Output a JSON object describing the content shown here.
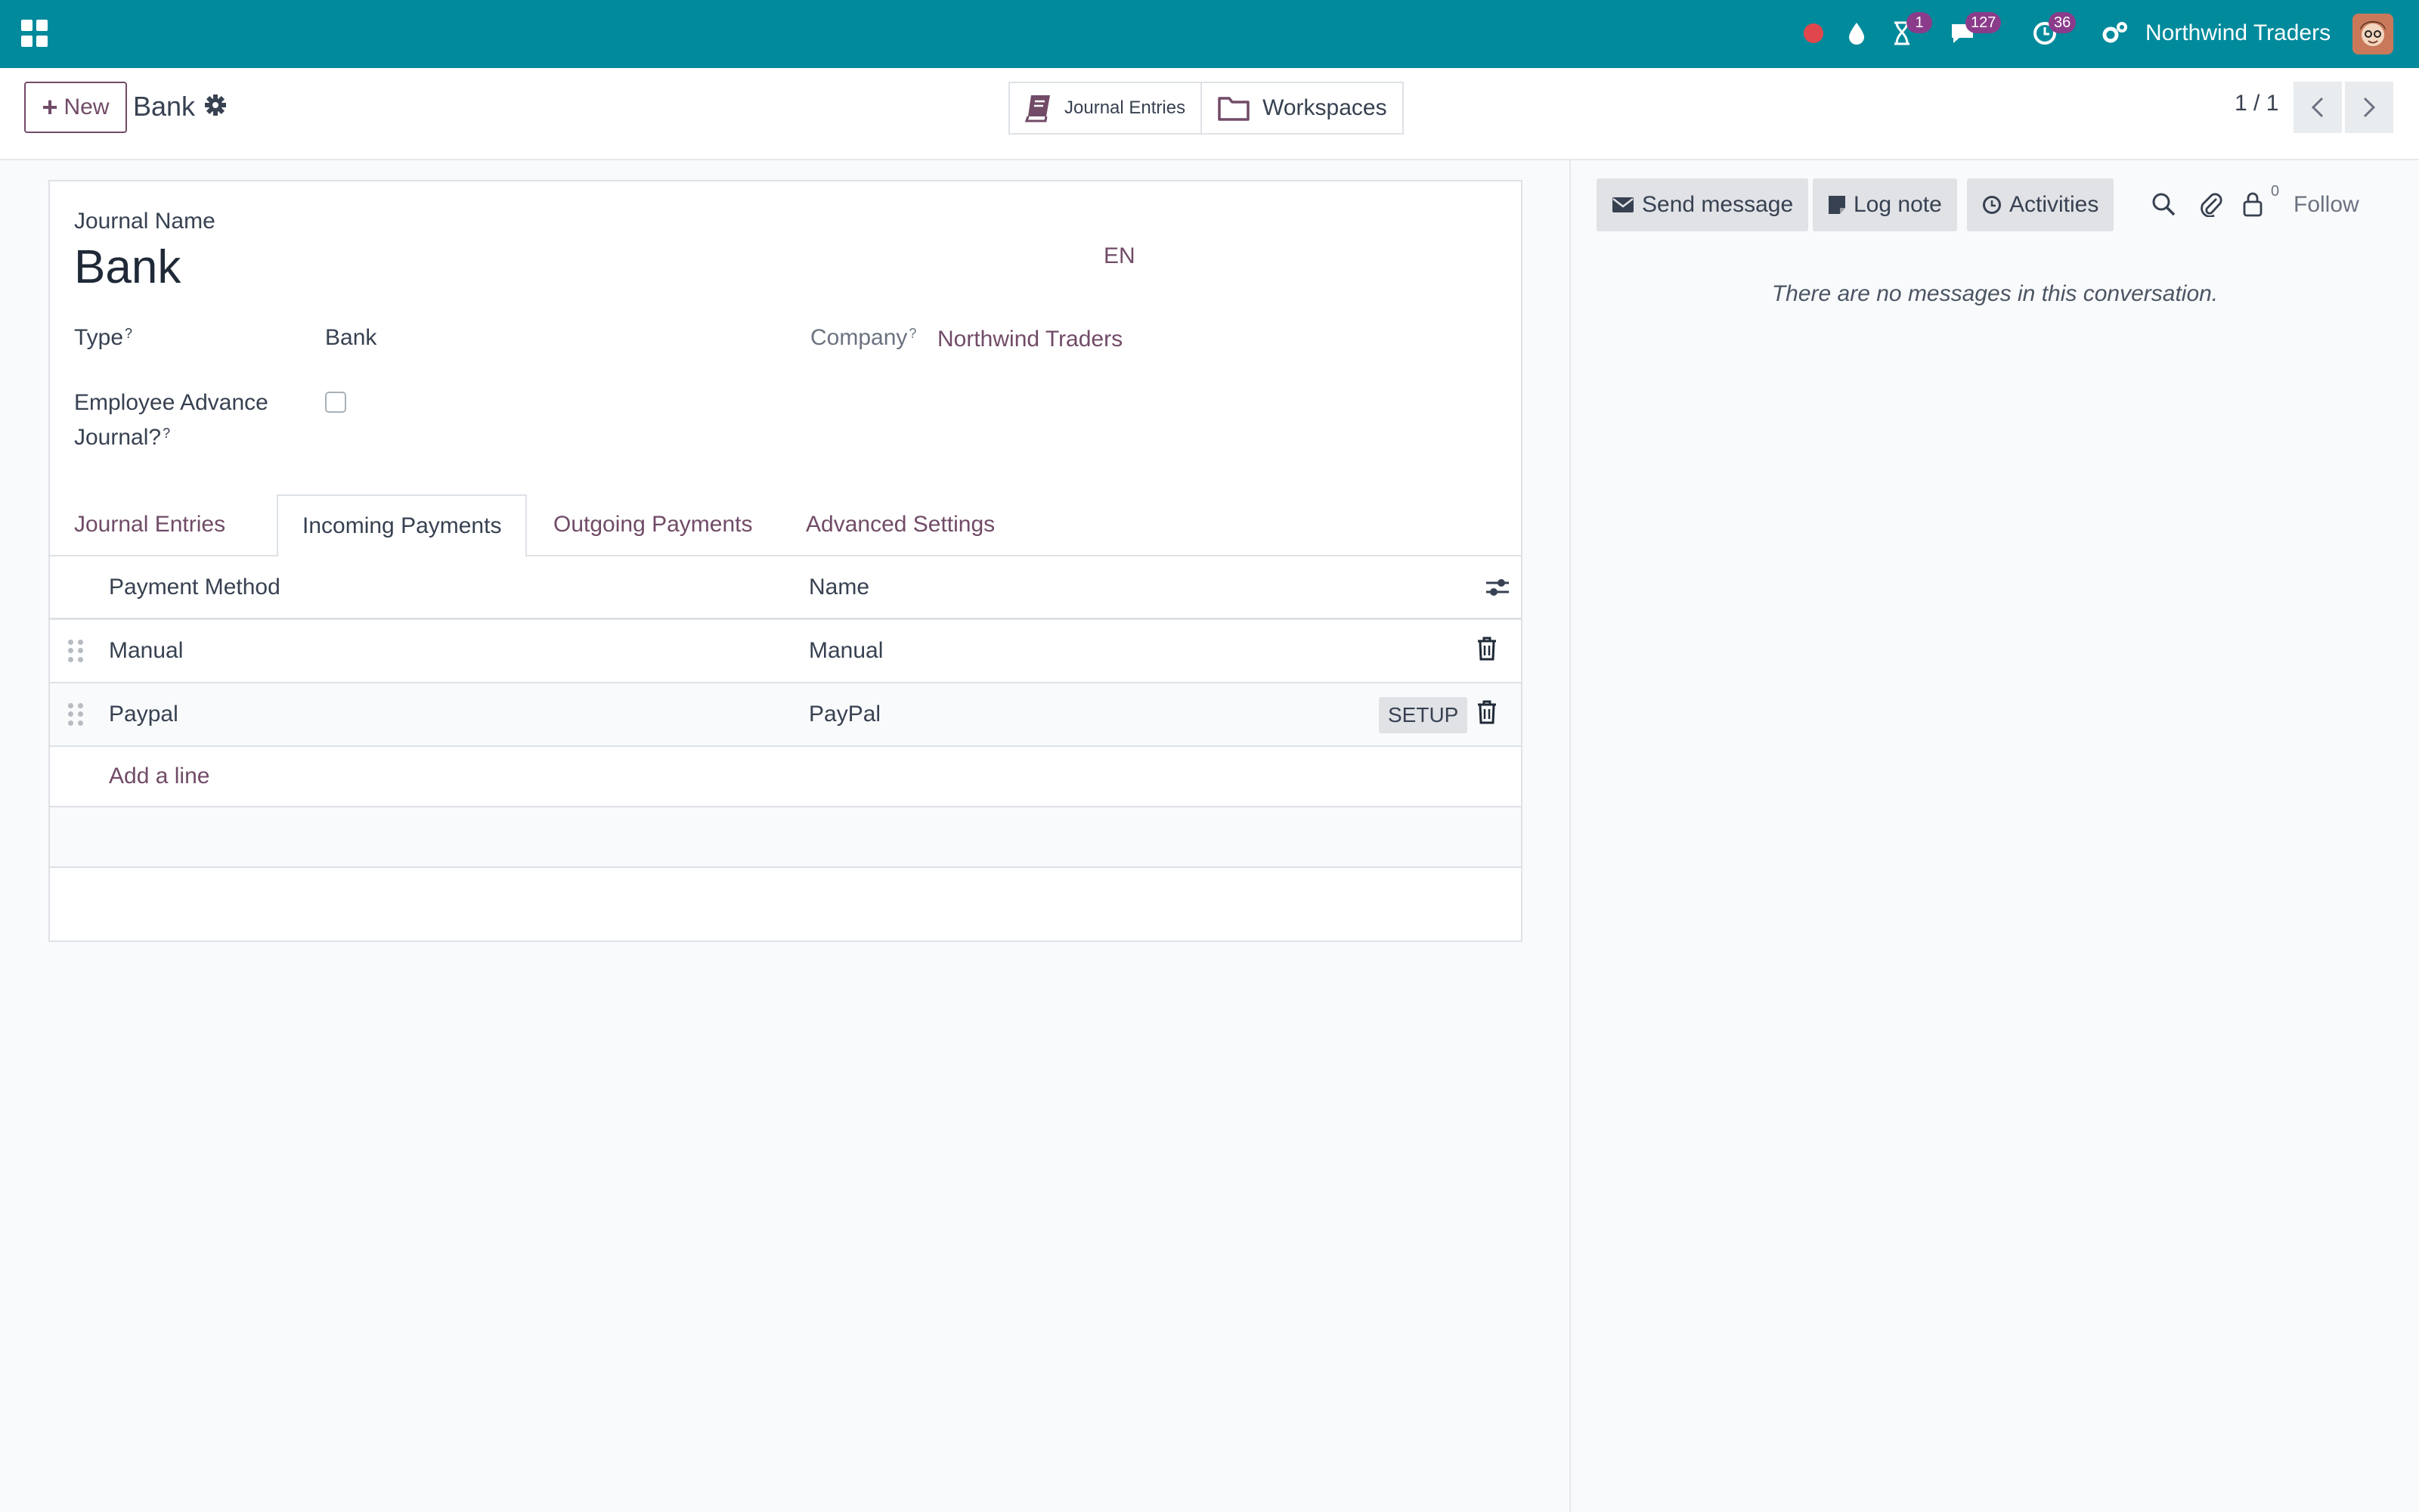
{
  "navbar": {
    "company_name": "Northwind Traders",
    "activity_count": "1",
    "messages_count": "127",
    "clock_count": "36",
    "icons": [
      "apps-icon",
      "record-dot-icon",
      "drop-icon",
      "hourglass-icon",
      "chat-icon",
      "clock-icon",
      "cogs-icon"
    ]
  },
  "control": {
    "new_label": "New",
    "breadcrumb_title": "Bank",
    "smart_buttons": {
      "journal_entries": "Journal Entries",
      "workspaces": "Workspaces"
    },
    "pager": "1 / 1"
  },
  "form": {
    "journal_name_label": "Journal Name",
    "journal_name_value": "Bank",
    "lang": "EN",
    "type_label": "Type",
    "type_value": "Bank",
    "company_label": "Company",
    "company_value": "Northwind Traders",
    "employee_advance_label_line1": "Employee Advance",
    "employee_advance_label_line2": "Journal?",
    "help_mark": "?",
    "employee_advance_checked": false
  },
  "tabs": [
    {
      "label": "Journal Entries"
    },
    {
      "label": "Incoming Payments"
    },
    {
      "label": "Outgoing Payments"
    },
    {
      "label": "Advanced Settings"
    }
  ],
  "active_tab": "Incoming Payments",
  "table": {
    "columns": [
      "Payment Method",
      "Name"
    ],
    "rows": [
      {
        "method": "Manual",
        "name": "Manual",
        "setup": ""
      },
      {
        "method": "Paypal",
        "name": "PayPal",
        "setup": "SETUP"
      }
    ],
    "add_line": "Add a line"
  },
  "chatter": {
    "send_message": "Send message",
    "log_note": "Log note",
    "activities": "Activities",
    "follower_count": "0",
    "follow": "Follow",
    "empty_text": "There are no messages in this conversation."
  },
  "colors": {
    "navbar": "#018a9c",
    "accent": "#714b67",
    "badge": "#8a3c8a"
  }
}
